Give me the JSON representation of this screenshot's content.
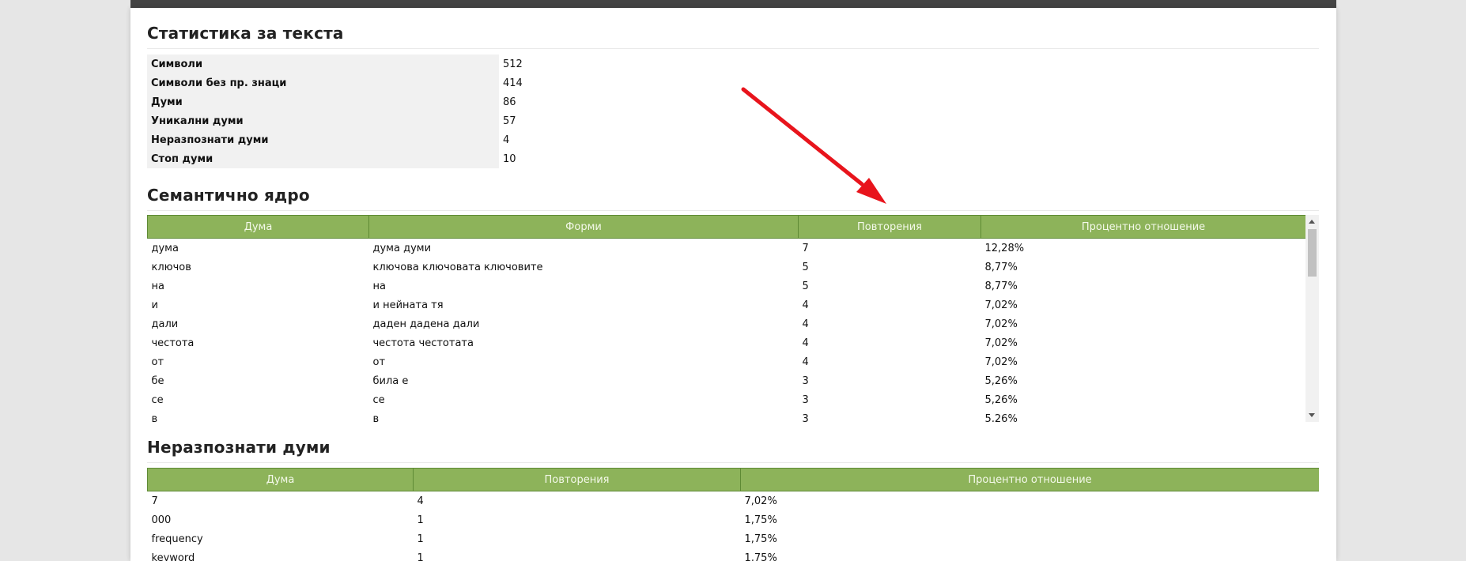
{
  "stats": {
    "title": "Статистика за текста",
    "rows": [
      {
        "label": "Символи",
        "value": "512"
      },
      {
        "label": "Символи без пр. знаци",
        "value": "414"
      },
      {
        "label": "Думи",
        "value": "86"
      },
      {
        "label": "Уникални думи",
        "value": "57"
      },
      {
        "label": "Неразпознати думи",
        "value": "4"
      },
      {
        "label": "Стоп думи",
        "value": "10"
      }
    ]
  },
  "semantic": {
    "title": "Семантично ядро",
    "headers": [
      "Дума",
      "Форми",
      "Повторения",
      "Процентно отношение"
    ],
    "rows": [
      [
        "дума",
        "дума думи",
        "7",
        "12,28%"
      ],
      [
        "ключов",
        "ключова ключовата ключовите",
        "5",
        "8,77%"
      ],
      [
        "на",
        "на",
        "5",
        "8,77%"
      ],
      [
        "и",
        "и нейната тя",
        "4",
        "7,02%"
      ],
      [
        "дали",
        "даден дадена дали",
        "4",
        "7,02%"
      ],
      [
        "честота",
        "честота честотата",
        "4",
        "7,02%"
      ],
      [
        "от",
        "от",
        "4",
        "7,02%"
      ],
      [
        "бе",
        "била е",
        "3",
        "5,26%"
      ],
      [
        "се",
        "се",
        "3",
        "5,26%"
      ],
      [
        "в",
        "в",
        "3",
        "5,26%"
      ]
    ]
  },
  "unrecognized": {
    "title": "Неразпознати думи",
    "headers": [
      "Дума",
      "Повторения",
      "Процентно отношение"
    ],
    "rows": [
      [
        "7",
        "4",
        "7,02%"
      ],
      [
        "000",
        "1",
        "1,75%"
      ],
      [
        "frequency",
        "1",
        "1,75%"
      ],
      [
        "keyword",
        "1",
        "1,75%"
      ]
    ]
  },
  "colors": {
    "header_bg": "#8db35a",
    "annotation_arrow": "#e8141c"
  },
  "icons": {
    "annotation": "red-arrow-icon"
  }
}
